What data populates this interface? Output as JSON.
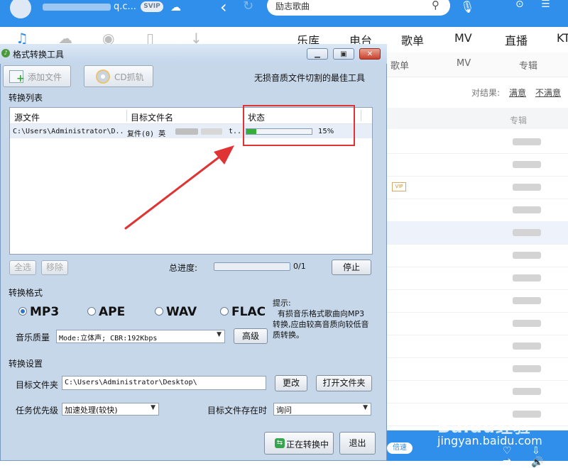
{
  "app": {
    "username_suffix": "q.c...",
    "badge": "SVIP",
    "search_value": "励志歌曲",
    "categories": [
      "乐库",
      "电台",
      "歌单",
      "MV",
      "直播",
      "KT"
    ],
    "subtabs": [
      "歌单",
      "MV",
      "专辑"
    ],
    "feedback_label": "对结果:",
    "feedback_good": "满意",
    "feedback_bad": "不满意",
    "column_album": "专辑",
    "vip_tag": "VIP",
    "speed_label": "倍速",
    "watermark": "Baidu经验",
    "watermark_url": "jingyan.baidu.com",
    "accent_color": "#2f8fea"
  },
  "dialog": {
    "title": "格式转换工具",
    "add_file": "添加文件",
    "cd_rip": "CD抓轨",
    "slogan": "无损音质文件切割的最佳工具",
    "list_label": "转换列表",
    "columns": [
      "源文件",
      "目标文件名",
      "状态"
    ],
    "row": {
      "source": "C:\\Users\\Administrator\\D..",
      "target_prefix": "复件(0) 英",
      "target_suffix": "t..",
      "progress": 0.15,
      "progress_text": "15%"
    },
    "select_all": "全选",
    "remove": "移除",
    "total_label": "总进度:",
    "total_progress": 0,
    "total_count": "0/1",
    "stop": "停止",
    "format_label": "转换格式",
    "formats": [
      {
        "name": "MP3",
        "selected": true
      },
      {
        "name": "APE",
        "selected": false
      },
      {
        "name": "WAV",
        "selected": false
      },
      {
        "name": "FLAC",
        "selected": false
      }
    ],
    "tip": "提示:\n  有损音乐格式歌曲向MP3转换,应由较高音质向较低音质转换。",
    "quality_label": "音乐质量",
    "quality_value": "Mode:立体声; CBR:192Kbps",
    "advanced": "高级",
    "settings_label": "转换设置",
    "target_folder_label": "目标文件夹",
    "target_folder_value": "C:\\Users\\Administrator\\Desktop\\",
    "change": "更改",
    "open_folder": "打开文件夹",
    "priority_label": "任务优先级",
    "priority_value": "加速处理(较快)",
    "exists_label": "目标文件存在时",
    "exists_value": "询问",
    "converting": "正在转换中",
    "exit": "退出",
    "annotation_color": "#e03333"
  }
}
